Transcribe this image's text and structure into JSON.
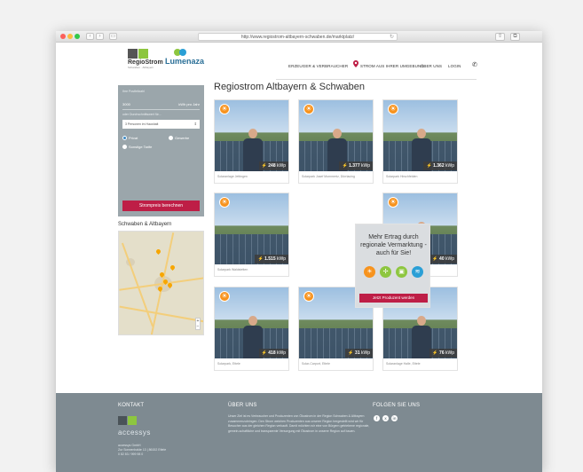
{
  "browser": {
    "url": "http://www.regiostrom-altbayern-schwaben.de/marktplatz/"
  },
  "header": {
    "logo_regiostrom": "RegioStrom",
    "logo_regiostrom_sub": "Schwaben · Altbayern",
    "logo_lumenaza": "Lumenaza",
    "nav": {
      "item1": "ERZEUGER & VERBRAUCHER",
      "item2": "STROM AUS IHRER UMGEBUNG",
      "item3": "ÜBER UNS",
      "item4": "LOGIN"
    }
  },
  "calculator": {
    "postcode_label": "Ihre Postleitzahl",
    "consumption_value": "3000",
    "consumption_unit": "kWh pro Jahr",
    "or_text": "oder Durchschnittswert für...",
    "household_select": "3 Personen im Haushalt",
    "radio_private": "Privat",
    "radio_business": "Gewerbe",
    "radio_other": "Sonstige Tarife",
    "submit_label": "Strompreis berechnen"
  },
  "region": {
    "title": "Schwaben & Altbayern"
  },
  "main": {
    "title": "Regiostrom Altbayern & Schwaben"
  },
  "producers": [
    {
      "caption": "Solaranlage Jettingen",
      "kwp": "248",
      "unit": "kWp"
    },
    {
      "caption": "Solarpark Josef Mommertz, Dürrlauing",
      "kwp": "1.377",
      "unit": "kWp"
    },
    {
      "caption": "Solarpark Hirschfelden",
      "kwp": "1.362",
      "unit": "kWp"
    },
    {
      "caption": "Solarpark Waldstetten",
      "kwp": "1.515",
      "unit": "kWp"
    },
    {
      "caption": "Solaranlage, Ettele",
      "kwp": "40",
      "unit": "kWp"
    },
    {
      "caption": "Solarpark, Ettele",
      "kwp": "418",
      "unit": "kWp"
    },
    {
      "caption": "Solar-Carport, Ettele",
      "kwp": "31",
      "unit": "kWp"
    },
    {
      "caption": "Solaranlage Halle, Ettele",
      "kwp": "76",
      "unit": "kWp"
    }
  ],
  "promo": {
    "text": "Mehr Ertrag durch regionale Vermarktung - auch für Sie!",
    "button": "Jetzt Produzent werden"
  },
  "footer": {
    "contact_title": "KONTAKT",
    "about_title": "ÜBER UNS",
    "follow_title": "FOLGEN SIE UNS",
    "company_logo": "accessys",
    "address_line1": "accessys GmbH",
    "address_line2": "Zur Sonnenhalde 13 | 86152 Ettele",
    "address_line3": "0 82 83 / 999 98 0",
    "about_text": "Unser Ziel ist es Verbraucher und Produzenten von Ökostrom in der Region Schwaben & Altbayern zusammenzubringen. Den Strom welchen Produzenten aus unserer Region hergestellt wird wir für Besucher aus der gleichen Region verkauft. Damit möchten wir eine von Bürgern getriebene regionale, gemein-schaftliche und transparente Versorgung mit Ökostrom in unserer Region auf bauen."
  },
  "colors": {
    "accent_red": "#be1e46",
    "sidebar_grey": "#9ba6ab",
    "footer_grey": "#7e8a91",
    "sun_orange": "#f7931e",
    "brand_green": "#8dc63f"
  }
}
